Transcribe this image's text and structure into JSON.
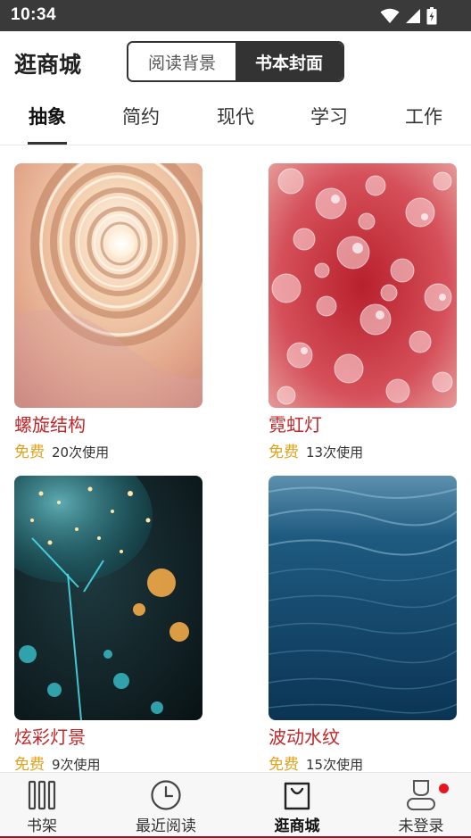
{
  "status_bar": {
    "time": "10:34"
  },
  "header": {
    "title": "逛商城",
    "segments": [
      {
        "label": "阅读背景",
        "active": false
      },
      {
        "label": "书本封面",
        "active": true
      }
    ]
  },
  "tabs": [
    {
      "label": "抽象",
      "active": true
    },
    {
      "label": "简约",
      "active": false
    },
    {
      "label": "现代",
      "active": false
    },
    {
      "label": "学习",
      "active": false
    },
    {
      "label": "工作",
      "active": false
    }
  ],
  "covers": [
    {
      "name": "螺旋结构",
      "price": "免费",
      "usage": "20次使用",
      "image": "spiral-staircase"
    },
    {
      "name": "霓虹灯",
      "price": "免费",
      "usage": "13次使用",
      "image": "red-bokeh"
    },
    {
      "name": "炫彩灯景",
      "price": "免费",
      "usage": "9次使用",
      "image": "cyan-balloon-lights"
    },
    {
      "name": "波动水纹",
      "price": "免费",
      "usage": "15次使用",
      "image": "blue-water-waves"
    }
  ],
  "bottom_nav": [
    {
      "label": "书架",
      "icon": "bookshelf-icon",
      "active": false
    },
    {
      "label": "最近阅读",
      "icon": "clock-icon",
      "active": false
    },
    {
      "label": "逛商城",
      "icon": "shopping-bag-icon",
      "active": true
    },
    {
      "label": "未登录",
      "icon": "user-icon",
      "active": false,
      "badge": true
    }
  ],
  "colors": {
    "status_bar": "#3a3a3a",
    "cover_name": "#c0282a",
    "price": "#e0a21c",
    "badge": "#e8141e",
    "segment_active": "#333333"
  }
}
